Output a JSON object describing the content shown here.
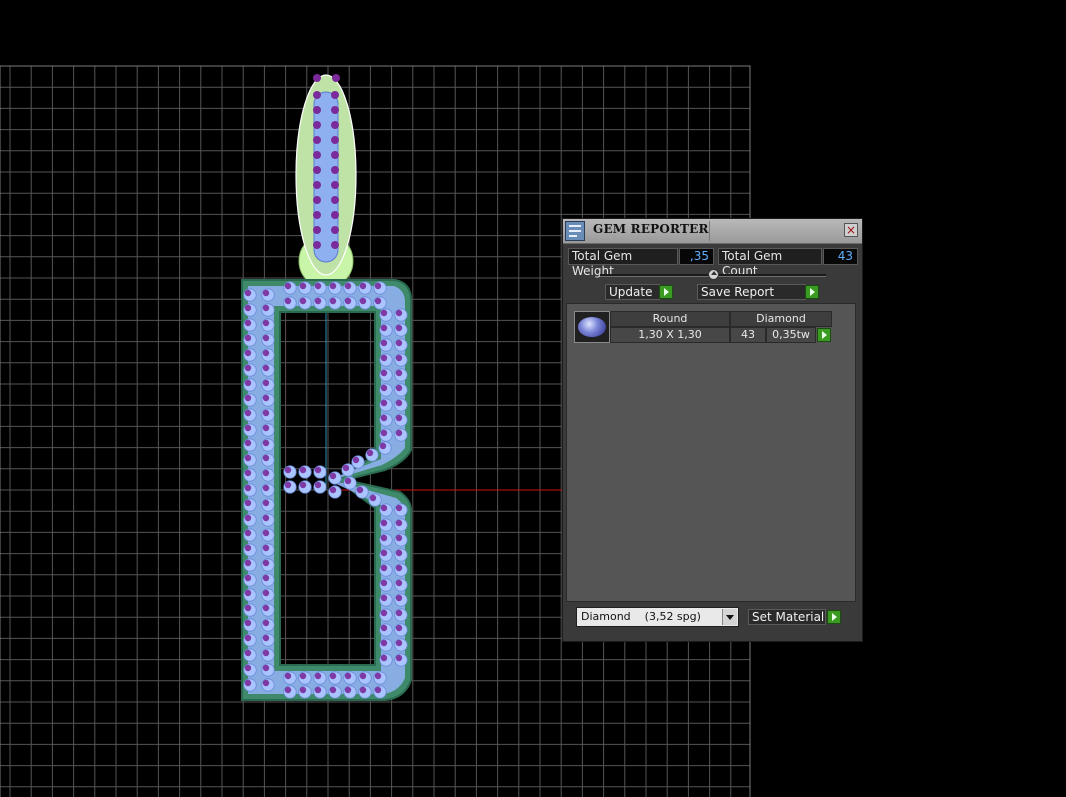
{
  "viewport": {
    "grid_color": "#555555",
    "axis_x_color": "#d01010",
    "axis_y_color": "#2a8fb0",
    "metal_color": "#3e8a6a",
    "stone_color": "#8fb0f0",
    "prong_color": "#7a2a9a"
  },
  "gem_reporter": {
    "title": "GEM REPORTER",
    "close_label": "×",
    "total_weight_label": "Total Gem Weight",
    "total_weight_value": ",35",
    "total_count_label": "Total Gem Count",
    "total_count_value": "43",
    "update_label": "Update",
    "save_report_label": "Save Report",
    "table": {
      "headers": [
        "Round",
        "Diamond"
      ],
      "rows": [
        {
          "size": "1,30 X 1,30",
          "count": "43",
          "weight": "0,35tw"
        }
      ]
    },
    "material_select_value": "Diamond    (3,52 spg)",
    "set_material_label": "Set Material"
  }
}
